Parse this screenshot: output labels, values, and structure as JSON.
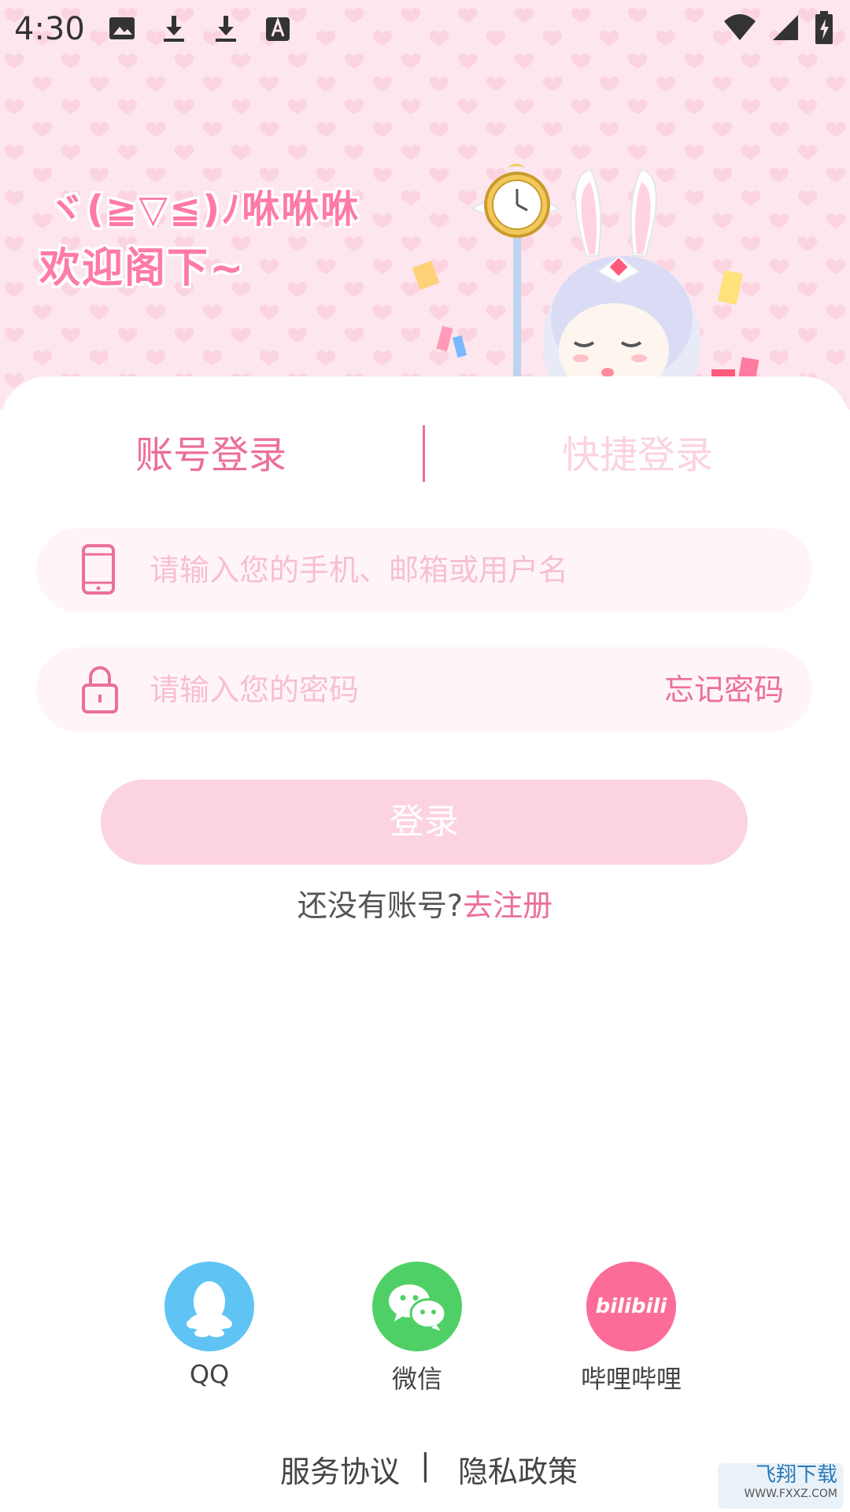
{
  "status_bar": {
    "time": "4:30",
    "left_icons": [
      "image-icon",
      "download-icon",
      "download-icon",
      "font-a-icon"
    ],
    "right_icons": [
      "wifi-icon",
      "signal-icon",
      "battery-charging-icon"
    ]
  },
  "header": {
    "greeting_line1": "ヾ(≧▽≦)ﾉ咻咻咻",
    "greeting_line2": "欢迎阁下~",
    "background_color": "#fde6ee"
  },
  "tabs": {
    "account_login": "账号登录",
    "quick_login": "快捷登录"
  },
  "form": {
    "account_placeholder": "请输入您的手机、邮箱或用户名",
    "password_placeholder": "请输入您的密码",
    "forgot_password": "忘记密码",
    "login_button": "登录"
  },
  "register": {
    "question": "还没有账号?",
    "link": "去注册"
  },
  "social_logins": [
    {
      "label": "QQ",
      "icon": "qq-icon",
      "color": "#5fc4f4"
    },
    {
      "label": "微信",
      "icon": "wechat-icon",
      "color": "#4fd066"
    },
    {
      "label": "哔哩哔哩",
      "icon": "bilibili-icon",
      "color": "#fb6d98",
      "icon_text": "bilibili"
    }
  ],
  "footer": {
    "terms": "服务协议",
    "separator": "|",
    "privacy": "隐私政策"
  },
  "watermark": {
    "title": "飞翔下载",
    "url": "WWW.FXXZ.COM"
  },
  "accent_color": "#ec6f9a"
}
